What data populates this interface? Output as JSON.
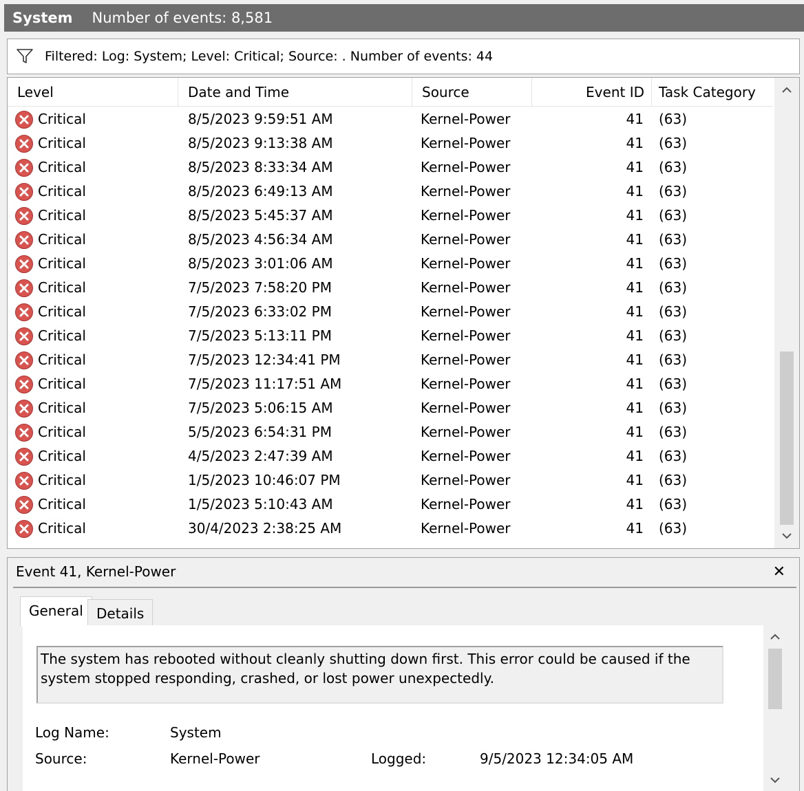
{
  "header": {
    "log_name": "System",
    "event_count": "Number of events: 8,581"
  },
  "filter": {
    "text": "Filtered: Log: System; Level: Critical; Source: . Number of events: 44"
  },
  "columns": {
    "level": "Level",
    "date_time": "Date and Time",
    "source": "Source",
    "event_id": "Event ID",
    "task_category": "Task Category"
  },
  "events": [
    {
      "level": "Critical",
      "date_time": "8/5/2023 9:59:51 AM",
      "source": "Kernel-Power",
      "event_id": "41",
      "task_category": "(63)"
    },
    {
      "level": "Critical",
      "date_time": "8/5/2023 9:13:38 AM",
      "source": "Kernel-Power",
      "event_id": "41",
      "task_category": "(63)"
    },
    {
      "level": "Critical",
      "date_time": "8/5/2023 8:33:34 AM",
      "source": "Kernel-Power",
      "event_id": "41",
      "task_category": "(63)"
    },
    {
      "level": "Critical",
      "date_time": "8/5/2023 6:49:13 AM",
      "source": "Kernel-Power",
      "event_id": "41",
      "task_category": "(63)"
    },
    {
      "level": "Critical",
      "date_time": "8/5/2023 5:45:37 AM",
      "source": "Kernel-Power",
      "event_id": "41",
      "task_category": "(63)"
    },
    {
      "level": "Critical",
      "date_time": "8/5/2023 4:56:34 AM",
      "source": "Kernel-Power",
      "event_id": "41",
      "task_category": "(63)"
    },
    {
      "level": "Critical",
      "date_time": "8/5/2023 3:01:06 AM",
      "source": "Kernel-Power",
      "event_id": "41",
      "task_category": "(63)"
    },
    {
      "level": "Critical",
      "date_time": "7/5/2023 7:58:20 PM",
      "source": "Kernel-Power",
      "event_id": "41",
      "task_category": "(63)"
    },
    {
      "level": "Critical",
      "date_time": "7/5/2023 6:33:02 PM",
      "source": "Kernel-Power",
      "event_id": "41",
      "task_category": "(63)"
    },
    {
      "level": "Critical",
      "date_time": "7/5/2023 5:13:11 PM",
      "source": "Kernel-Power",
      "event_id": "41",
      "task_category": "(63)"
    },
    {
      "level": "Critical",
      "date_time": "7/5/2023 12:34:41 PM",
      "source": "Kernel-Power",
      "event_id": "41",
      "task_category": "(63)"
    },
    {
      "level": "Critical",
      "date_time": "7/5/2023 11:17:51 AM",
      "source": "Kernel-Power",
      "event_id": "41",
      "task_category": "(63)"
    },
    {
      "level": "Critical",
      "date_time": "7/5/2023 5:06:15 AM",
      "source": "Kernel-Power",
      "event_id": "41",
      "task_category": "(63)"
    },
    {
      "level": "Critical",
      "date_time": "5/5/2023 6:54:31 PM",
      "source": "Kernel-Power",
      "event_id": "41",
      "task_category": "(63)"
    },
    {
      "level": "Critical",
      "date_time": "4/5/2023 2:47:39 AM",
      "source": "Kernel-Power",
      "event_id": "41",
      "task_category": "(63)"
    },
    {
      "level": "Critical",
      "date_time": "1/5/2023 10:46:07 PM",
      "source": "Kernel-Power",
      "event_id": "41",
      "task_category": "(63)"
    },
    {
      "level": "Critical",
      "date_time": "1/5/2023 5:10:43 AM",
      "source": "Kernel-Power",
      "event_id": "41",
      "task_category": "(63)"
    },
    {
      "level": "Critical",
      "date_time": "30/4/2023 2:38:25 AM",
      "source": "Kernel-Power",
      "event_id": "41",
      "task_category": "(63)"
    }
  ],
  "detail": {
    "title": "Event 41, Kernel-Power",
    "close_symbol": "✕",
    "tabs": [
      "General",
      "Details"
    ],
    "description": "The system has rebooted without cleanly shutting down first. This error could be caused if the system stopped responding, crashed, or lost power unexpectedly.",
    "log_name_label": "Log Name:",
    "log_name_value": "System",
    "source_label": "Source:",
    "source_value": "Kernel-Power",
    "logged_label": "Logged:",
    "logged_value": "9/5/2023 12:34:05 AM"
  },
  "colors": {
    "titlebar": "#6d6d6d",
    "critical_icon": "#d9534f",
    "scroll_thumb": "#cdcdcd"
  },
  "icons": {
    "filter": "funnel-icon",
    "level": "critical-x-circle-icon",
    "scroll_up": "chevron-up-icon",
    "scroll_down": "chevron-down-icon"
  }
}
